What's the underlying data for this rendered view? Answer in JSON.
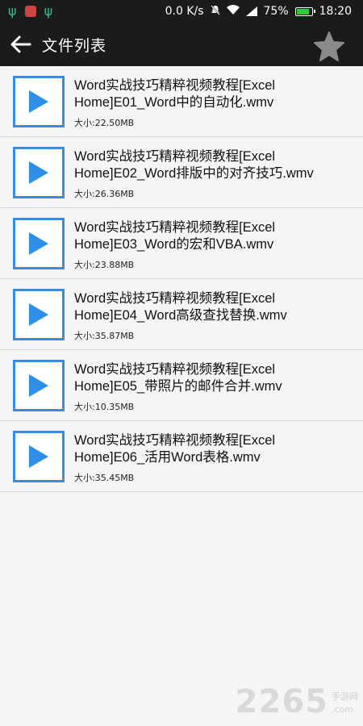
{
  "status_bar": {
    "speed": "0.0 K/s",
    "battery": "75%",
    "time": "18:20"
  },
  "app_bar": {
    "title": "文件列表"
  },
  "files": [
    {
      "name_line1": "Word实战技巧精粹视频教程[Excel",
      "name_line2": "Home]E01_Word中的自动化.wmv",
      "size": "大小:22.50MB"
    },
    {
      "name_line1": "Word实战技巧精粹视频教程[Excel",
      "name_line2": "Home]E02_Word排版中的对齐技巧.wmv",
      "size": "大小:26.36MB"
    },
    {
      "name_line1": "Word实战技巧精粹视频教程[Excel",
      "name_line2": "Home]E03_Word的宏和VBA.wmv",
      "size": "大小:23.88MB"
    },
    {
      "name_line1": "Word实战技巧精粹视频教程[Excel",
      "name_line2": "Home]E04_Word高级查找替换.wmv",
      "size": "大小:35.87MB"
    },
    {
      "name_line1": "Word实战技巧精粹视频教程[Excel",
      "name_line2": "Home]E05_带照片的邮件合并.wmv",
      "size": "大小:10.35MB"
    },
    {
      "name_line1": "Word实战技巧精粹视频教程[Excel",
      "name_line2": "Home]E06_活用Word表格.wmv",
      "size": "大小:35.45MB"
    }
  ],
  "watermark": {
    "number": "2265",
    "text": "手游网",
    "domain": ".com"
  },
  "colors": {
    "accent": "#2f8fe6",
    "bar": "#1b1b1b"
  }
}
